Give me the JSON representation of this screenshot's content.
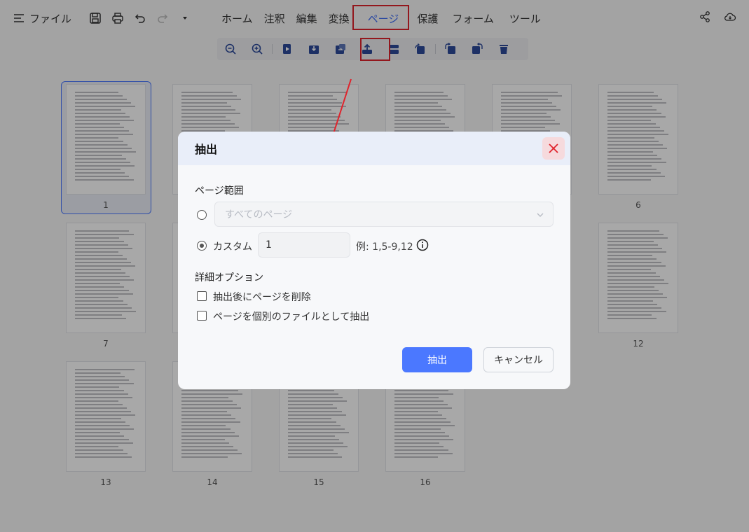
{
  "topbar": {
    "file_label": "ファイル",
    "menu": [
      "ホーム",
      "注釈",
      "編集",
      "変換",
      "ページ",
      "保護",
      "フォーム",
      "ツール"
    ],
    "active_menu": "ページ"
  },
  "ribbon": {
    "buttons": [
      "zoom-out",
      "zoom-in",
      "insert-page",
      "import-page",
      "replace-page",
      "extract-page",
      "split-page",
      "crop-page",
      "rotate-left",
      "rotate-right",
      "delete-page"
    ]
  },
  "thumbnails": {
    "page_numbers": [
      "1",
      "6",
      "7",
      "12",
      "13",
      "14",
      "15",
      "16"
    ]
  },
  "dialog": {
    "title": "抽出",
    "page_range_label": "ページ範囲",
    "all_pages_placeholder": "すべてのページ",
    "custom_label": "カスタム",
    "custom_value": "1",
    "example": "例: 1,5-9,12",
    "advanced_label": "詳細オプション",
    "option_delete": "抽出後にページを削除",
    "option_separate": "ページを個別のファイルとして抽出",
    "extract_button": "抽出",
    "cancel_button": "キャンセル"
  },
  "colors": {
    "accent": "#4b78ff",
    "highlight": "#e0232c"
  }
}
